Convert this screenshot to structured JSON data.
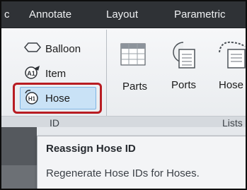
{
  "tabs": [
    {
      "label": "c"
    },
    {
      "label": "Annotate"
    },
    {
      "label": "Layout"
    },
    {
      "label": "Parametric"
    }
  ],
  "id_panel": {
    "balloon_label": "Balloon",
    "item_label": "Item",
    "hose_label": "Hose",
    "footer": "ID"
  },
  "lists_panel": {
    "parts_label": "Parts",
    "ports_label": "Ports",
    "hose_label": "Hose",
    "footer": "Lists"
  },
  "tooltip": {
    "title": "Reassign Hose ID",
    "description": "Regenerate Hose IDs for Hoses."
  },
  "colors": {
    "highlight": "#b81c22",
    "selected_button": "#c9e2f6",
    "tabbar": "#2f3236"
  }
}
